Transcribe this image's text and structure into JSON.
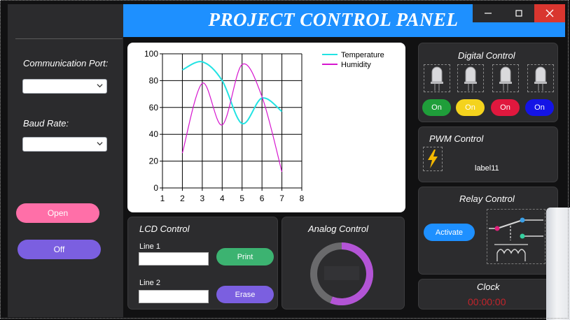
{
  "header": {
    "title": "PROJECT CONTROL PANEL"
  },
  "sidebar": {
    "comm_port_label": "Communication Port:",
    "comm_port_value": "",
    "baud_rate_label": "Baud Rate:",
    "baud_rate_value": "",
    "open_label": "Open",
    "off_label": "Off"
  },
  "chart_data": {
    "type": "line",
    "title": "",
    "xlabel": "",
    "ylabel": "",
    "xlim": [
      1,
      8
    ],
    "ylim": [
      0,
      100
    ],
    "x_ticks": [
      1,
      2,
      3,
      4,
      5,
      6,
      7,
      8
    ],
    "y_ticks": [
      0,
      20,
      40,
      60,
      80,
      100
    ],
    "grid": true,
    "legend": "top-right",
    "series": [
      {
        "name": "Temperature",
        "color": "#22e3e3",
        "x": [
          2,
          3,
          4,
          5,
          6,
          7
        ],
        "y": [
          88,
          94,
          80,
          48,
          67,
          57
        ]
      },
      {
        "name": "Humidity",
        "color": "#d616cf",
        "x": [
          2,
          3,
          4,
          5,
          6,
          7
        ],
        "y": [
          26,
          78,
          47,
          92,
          68,
          12
        ]
      }
    ]
  },
  "lcd": {
    "title": "LCD Control",
    "line1_label": "Line 1",
    "line1_value": "",
    "line2_label": "Line 2",
    "line2_value": "",
    "print_label": "Print",
    "erase_label": "Erase"
  },
  "analog": {
    "title": "Analog Control",
    "gauge_level_percent": 56,
    "gauge_color": "#b354d6",
    "track_color": "#6a6a6c"
  },
  "digital": {
    "title": "Digital Control",
    "buttons": [
      {
        "label": "On",
        "color": "#1f9e3a"
      },
      {
        "label": "On",
        "color": "#f4d31d"
      },
      {
        "label": "On",
        "color": "#e0183e"
      },
      {
        "label": "On",
        "color": "#1414e6"
      }
    ]
  },
  "pwm": {
    "title": "PWM Control",
    "value_label": "label11",
    "icon": "lightning-icon"
  },
  "relay": {
    "title": "Relay Control",
    "activate_label": "Activate",
    "icon": "relay-switch-icon"
  },
  "clock": {
    "title": "Clock",
    "time": "00:00:00",
    "time_color": "#c2242b"
  },
  "window": {
    "minimize_icon": "minimize-icon",
    "maximize_icon": "maximize-icon",
    "close_icon": "close-icon"
  }
}
